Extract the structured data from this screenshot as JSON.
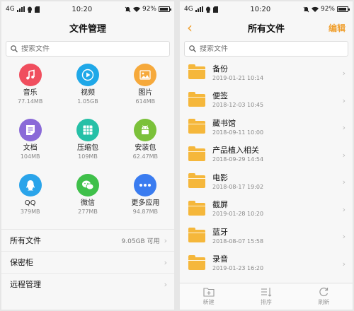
{
  "status": {
    "network": "4G",
    "time": "10:20",
    "battery": "92%",
    "battery_level": 0.92
  },
  "left": {
    "title": "文件管理",
    "search_placeholder": "搜索文件",
    "categories": [
      {
        "label": "音乐",
        "size": "77.14MB",
        "icon": "music-icon",
        "color": "#f04e5e"
      },
      {
        "label": "视频",
        "size": "1.05GB",
        "icon": "video-icon",
        "color": "#1fa8e8"
      },
      {
        "label": "图片",
        "size": "614MB",
        "icon": "image-icon",
        "color": "#f6a93b"
      },
      {
        "label": "文档",
        "size": "104MB",
        "icon": "document-icon",
        "color": "#8a6ad8"
      },
      {
        "label": "压缩包",
        "size": "109MB",
        "icon": "archive-icon",
        "color": "#26c0a7"
      },
      {
        "label": "安装包",
        "size": "62.47MB",
        "icon": "android-icon",
        "color": "#7bc13a"
      },
      {
        "label": "QQ",
        "size": "379MB",
        "icon": "qq-icon",
        "color": "#2aa4ea"
      },
      {
        "label": "微信",
        "size": "277MB",
        "icon": "wechat-icon",
        "color": "#3fc04a"
      },
      {
        "label": "更多应用",
        "size": "94.87MB",
        "icon": "more-icon",
        "color": "#3a7cf0"
      }
    ],
    "rows": [
      {
        "label": "所有文件",
        "extra": "9.05GB 可用"
      },
      {
        "label": "保密柜",
        "extra": ""
      },
      {
        "label": "远程管理",
        "extra": ""
      }
    ]
  },
  "right": {
    "title": "所有文件",
    "edit_label": "编辑",
    "search_placeholder": "搜索文件",
    "folders": [
      {
        "name": "备份",
        "date": "2019-01-21 10:14"
      },
      {
        "name": "便签",
        "date": "2018-12-03 10:45"
      },
      {
        "name": "藏书馆",
        "date": "2018-09-11 10:00"
      },
      {
        "name": "产品植入相关",
        "date": "2018-09-29 14:54"
      },
      {
        "name": "电影",
        "date": "2018-08-17 19:02"
      },
      {
        "name": "截屏",
        "date": "2019-01-28 10:20"
      },
      {
        "name": "蓝牙",
        "date": "2018-08-07 15:58"
      },
      {
        "name": "录音",
        "date": "2019-01-23 16:20"
      }
    ],
    "toolbar": [
      {
        "label": "新建",
        "icon": "new-folder-icon"
      },
      {
        "label": "排序",
        "icon": "sort-icon"
      },
      {
        "label": "刷新",
        "icon": "refresh-icon"
      }
    ]
  }
}
